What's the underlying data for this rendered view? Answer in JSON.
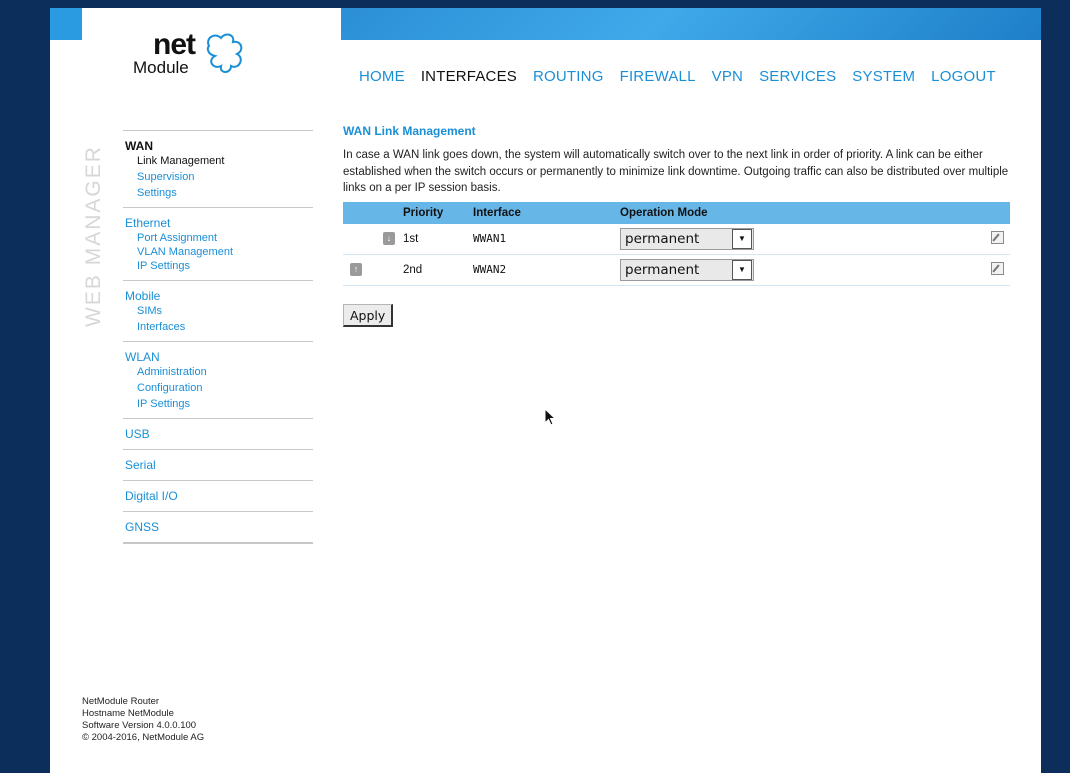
{
  "brand": {
    "net": "net",
    "module": "Module"
  },
  "nav": [
    "HOME",
    "INTERFACES",
    "ROUTING",
    "FIREWALL",
    "VPN",
    "SERVICES",
    "SYSTEM",
    "LOGOUT"
  ],
  "nav_active": "INTERFACES",
  "vertical_label": "WEB MANAGER",
  "sidebar": {
    "wan": {
      "label": "WAN",
      "items": [
        "Link Management",
        "Supervision",
        "Settings"
      ]
    },
    "ethernet": {
      "label": "Ethernet",
      "items": [
        "Port Assignment",
        "VLAN Management",
        "IP Settings"
      ]
    },
    "mobile": {
      "label": "Mobile",
      "items": [
        "SIMs",
        "Interfaces"
      ]
    },
    "wlan": {
      "label": "WLAN",
      "items": [
        "Administration",
        "Configuration",
        "IP Settings"
      ]
    },
    "usb": "USB",
    "serial": "Serial",
    "digital_io": "Digital I/O",
    "gnss": "GNSS"
  },
  "footer": [
    "NetModule Router",
    "Hostname NetModule",
    "Software Version 4.0.0.100",
    "© 2004-2016, NetModule AG"
  ],
  "content": {
    "title": "WAN Link Management",
    "description": "In case a WAN link goes down, the system will automatically switch over to the next link in order of priority. A link can be either established when the switch occurs or permanently to minimize link downtime. Outgoing traffic can also be distributed over multiple links on a per IP session basis.",
    "table": {
      "headers": {
        "priority": "Priority",
        "interface": "Interface",
        "mode": "Operation Mode"
      },
      "rows": [
        {
          "priority": "1st",
          "interface": "WWAN1",
          "mode": "permanent"
        },
        {
          "priority": "2nd",
          "interface": "WWAN2",
          "mode": "permanent"
        }
      ]
    },
    "apply_label": "Apply"
  },
  "colors": {
    "accent": "#1a8fd6",
    "header_bg": "#67b6e8",
    "outer_bg": "#0b2f5a"
  }
}
